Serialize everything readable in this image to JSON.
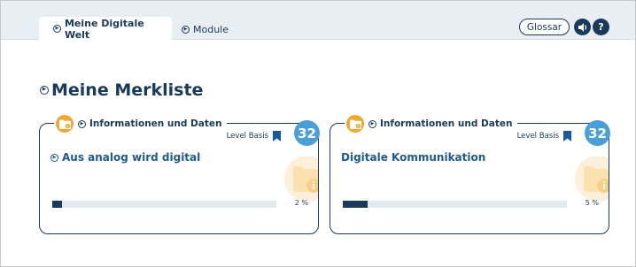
{
  "tabs": {
    "active_label": "Meine Digitale Welt",
    "inactive_label": "Module"
  },
  "header": {
    "glossar_label": "Glossar",
    "help_label": "?",
    "audio_icon": "speaker-icon"
  },
  "page": {
    "title": "Meine Merkliste"
  },
  "cards": [
    {
      "legend": "Informationen und Daten",
      "level": "Level Basis",
      "number": "32",
      "title": "Aus analog wird digital",
      "title_has_arrow": true,
      "progress": 0.02,
      "progress_label": "2 %"
    },
    {
      "legend": "Informationen und Daten",
      "level": "Level Basis",
      "number": "32",
      "title": "Digitale Kommunikation",
      "title_has_arrow": false,
      "progress": 0.05,
      "progress_label": "5 %"
    }
  ],
  "colors": {
    "navy": "#1a3a5c",
    "accent_blue": "#4a9fd9",
    "folder_orange": "#f0a830",
    "watermark": "#fbe7c4"
  }
}
